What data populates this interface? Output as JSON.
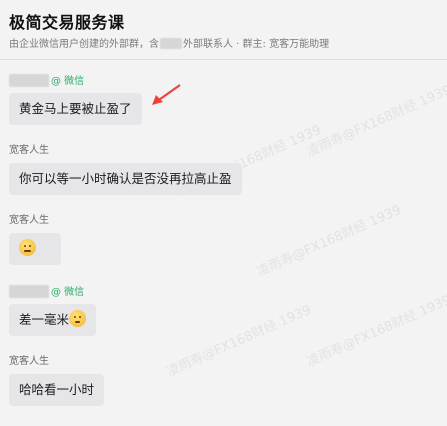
{
  "header": {
    "title": "极简交易服务课",
    "subtitle_prefix": "由企业微信用户创建的外部群，含",
    "subtitle_suffix": "外部联系人 · 群主: 宽客万能助理"
  },
  "messages": [
    {
      "sender": "",
      "source": "@ 微信",
      "text": "黄金马上要被止盈了",
      "emoji": false
    },
    {
      "sender": "宽客人生",
      "source": "",
      "text": "你可以等一小时确认是否没再拉高止盈",
      "emoji": false
    },
    {
      "sender": "宽客人生",
      "source": "",
      "text": "",
      "emoji": true,
      "emoji_name": "thinking-emoji"
    },
    {
      "sender": "",
      "source": "@ 微信",
      "text": "差一毫米",
      "emoji": true,
      "emoji_name": "flushed-emoji"
    },
    {
      "sender": "宽客人生",
      "source": "",
      "text": "哈哈看一小时",
      "emoji": false
    }
  ],
  "watermark": "凌雨寿@FX168财经 1939",
  "colors": {
    "wechat_green": "#2aae67",
    "annotation_red": "#e8463c"
  }
}
